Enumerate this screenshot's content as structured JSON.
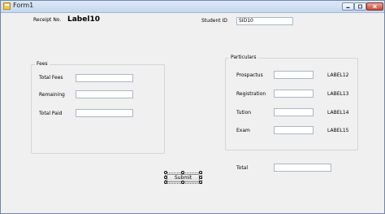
{
  "window": {
    "title": "Form1"
  },
  "receipt": {
    "label": "Receipt No.",
    "value": "Label10"
  },
  "student": {
    "label": "Student ID",
    "value": "SID10"
  },
  "fees": {
    "group_title": "Fees",
    "total_fees_label": "Total Fees",
    "remaining_label": "Remaining",
    "total_paid_label": "Total Paid",
    "total_fees_value": "",
    "remaining_value": "",
    "total_paid_value": ""
  },
  "particulars": {
    "group_title": "Particulars",
    "rows": [
      {
        "label": "Prospactus",
        "value": "",
        "amount": "LABEL12"
      },
      {
        "label": "Registration",
        "value": "",
        "amount": "LABEL13"
      },
      {
        "label": "Tution",
        "value": "",
        "amount": "LABEL14"
      },
      {
        "label": "Exam",
        "value": "",
        "amount": "LABEL15"
      }
    ]
  },
  "total": {
    "label": "Total",
    "value": ""
  },
  "submit_label": "Submit"
}
